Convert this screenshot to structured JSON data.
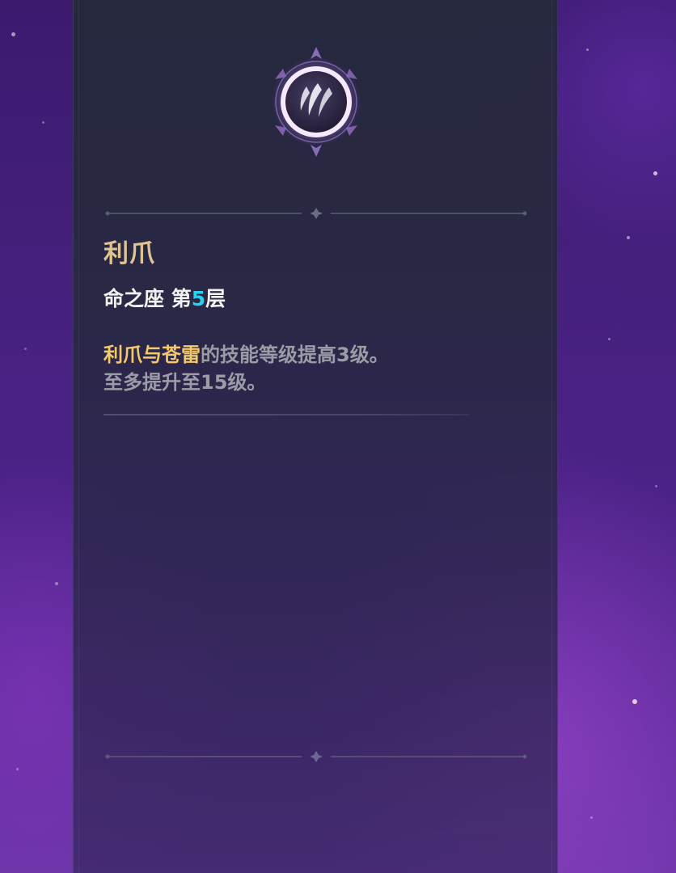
{
  "skill": {
    "icon": "claw-slash-icon",
    "name": "利爪",
    "constellation_prefix": "命之座 第",
    "constellation_level": "5",
    "constellation_suffix": "层",
    "description_highlight": "利爪与苍雷",
    "description_line1_rest": "的技能等级提高3级。",
    "description_line2": "至多提升至15级。"
  },
  "colors": {
    "title_gold": "#dfc392",
    "level_cyan": "#29d2ee",
    "highlight_gold": "#f3c96c",
    "body_grey": "#9b9ca6",
    "emblem_glow": "#d6a8ff"
  }
}
